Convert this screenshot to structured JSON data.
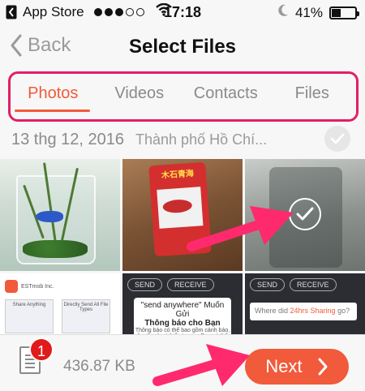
{
  "status_bar": {
    "carrier": "App Store",
    "signal_filled": 3,
    "signal_total": 5,
    "time": "17:18",
    "battery_text": "41%",
    "battery_level": 0.41
  },
  "nav": {
    "back_label": "Back",
    "title": "Select Files"
  },
  "tabs": [
    {
      "label": "Photos",
      "active": true
    },
    {
      "label": "Videos",
      "active": false
    },
    {
      "label": "Contacts",
      "active": false
    },
    {
      "label": "Files",
      "active": false
    }
  ],
  "date_group": {
    "date": "13 thg 12, 2016",
    "location": "Thành phố Hồ Chí..."
  },
  "grid": {
    "tile2_packet_text": "木石青海",
    "tile4": {
      "developer": "ESTmob Inc.",
      "shot1": "Share Anything",
      "shot2": "Directly Send All File Types"
    },
    "tile5": {
      "send": "SEND",
      "receive": "RECEIVE",
      "popup_title": "\"send anywhere\" Muốn Gửi",
      "popup_subtitle": "Thông báo cho Bạn",
      "popup_body": "Thông báo có thể bao gồm cảnh báo, âm thanh và biểu tượng. Bạn có thể"
    },
    "tile6": {
      "send": "SEND",
      "receive": "RECEIVE",
      "where_prefix": "Where did ",
      "where_highlight": "24hrs Sharing",
      "where_suffix": " go?"
    }
  },
  "bottom": {
    "badge_count": "1",
    "size": "436.87 KB",
    "next_label": "Next"
  },
  "colors": {
    "accent": "#f15a3a",
    "highlight_box": "#e21f66",
    "badge": "#e11a1a",
    "arrow": "#ff2a6d"
  }
}
